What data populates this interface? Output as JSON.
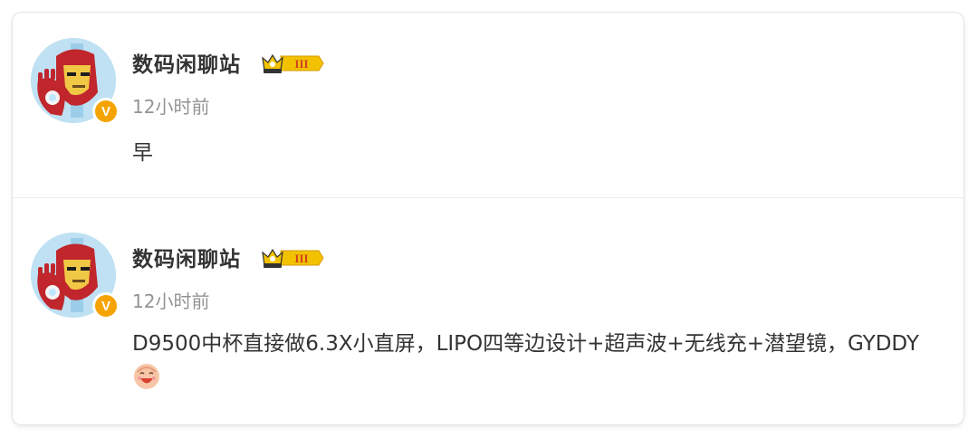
{
  "posts": [
    {
      "username": "数码闲聊站",
      "badge_level": "III",
      "verified_mark": "V",
      "time": "12小时前",
      "content": "早"
    },
    {
      "username": "数码闲聊站",
      "badge_level": "III",
      "verified_mark": "V",
      "time": "12小时前",
      "content": "D9500中杯直接做6.3X小直屏，LIPO四等边设计+超声波+无线充+潜望镜，GYDDY",
      "emoji": "laughing-face-emoji"
    }
  ],
  "colors": {
    "verified": "#f5a300",
    "time_text": "#939393",
    "name_text": "#333333",
    "badge_gold": "#f2c200"
  }
}
